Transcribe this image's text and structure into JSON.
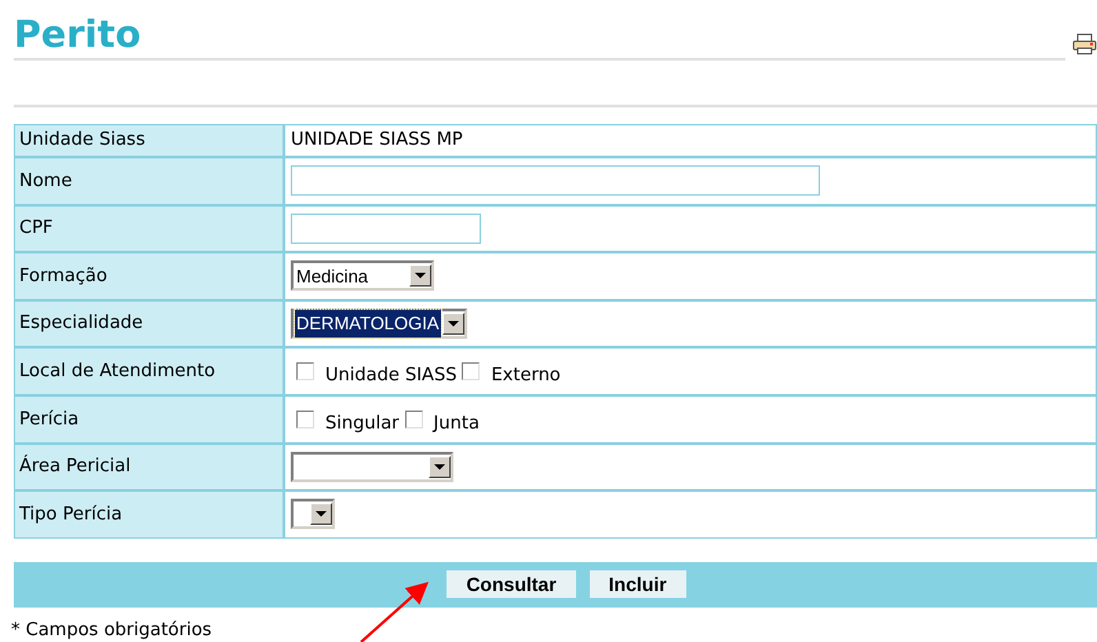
{
  "title": "Perito",
  "fields": [
    {
      "label": "Unidade Siass",
      "kind": "text",
      "value": "UNIDADE SIASS MP"
    },
    {
      "label": "Nome",
      "kind": "input"
    },
    {
      "label": "CPF",
      "kind": "input"
    },
    {
      "label": "Formação",
      "kind": "select",
      "value": "Medicina",
      "focused": false
    },
    {
      "label": "Especialidade",
      "kind": "select",
      "value": "DERMATOLOGIA",
      "focused": true
    },
    {
      "label": "Local de Atendimento",
      "kind": "checkboxes",
      "options": [
        {
          "label": "Unidade SIASS",
          "checked": false
        },
        {
          "label": "Externo",
          "checked": false
        }
      ]
    },
    {
      "label": "Perícia",
      "kind": "checkboxes",
      "options": [
        {
          "label": "Singular",
          "checked": false
        },
        {
          "label": "Junta",
          "checked": false
        }
      ]
    },
    {
      "label": "Área Pericial",
      "kind": "select"
    },
    {
      "label": "Tipo Perícia",
      "kind": "select"
    }
  ],
  "buttons": [
    "Consultar",
    "Incluir"
  ],
  "footnote": "* Campos obrigatórios"
}
